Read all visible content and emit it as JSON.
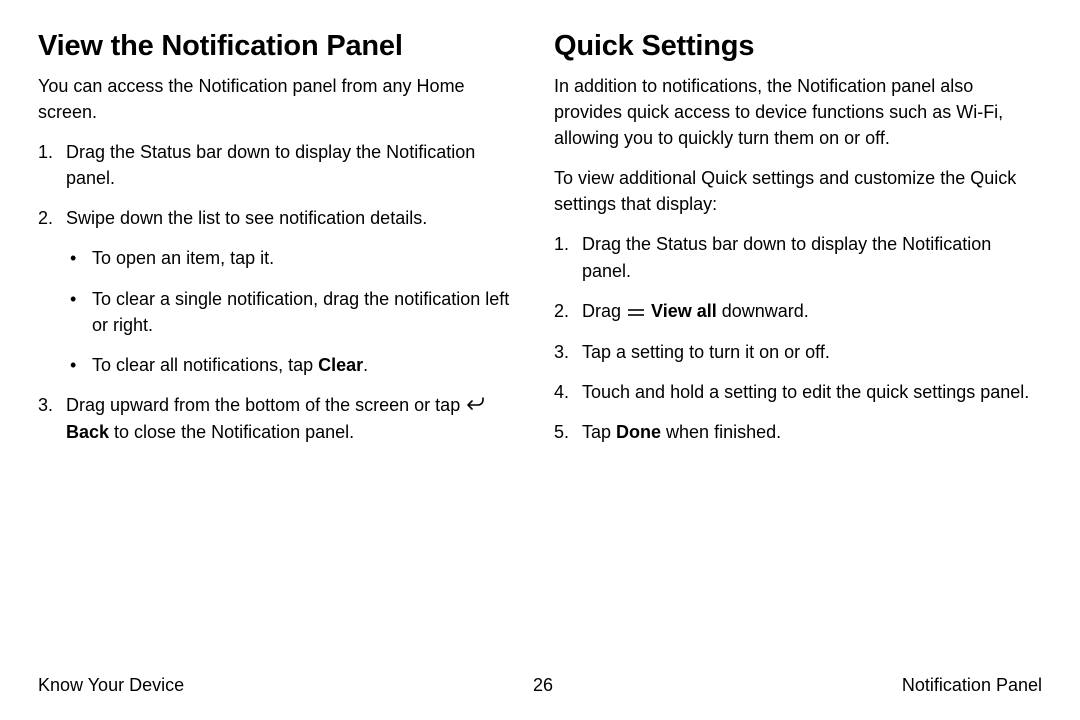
{
  "left": {
    "heading": "View the Notification Panel",
    "intro": "You can access the Notification panel from any Home screen.",
    "step1": "Drag the Status bar down to display the Notification panel.",
    "step2": "Swipe down the list to see notification details.",
    "bullet1": "To open an item, tap it.",
    "bullet2": "To clear a single notification, drag the notification left or right.",
    "bullet3_pre": "To clear all notifications, tap ",
    "bullet3_bold": "Clear",
    "bullet3_post": ".",
    "step3_pre": "Drag upward from the bottom of the screen or tap ",
    "step3_bold": "Back",
    "step3_post": " to close the Notification panel."
  },
  "right": {
    "heading": "Quick Settings",
    "intro1": "In addition to notifications, the Notification panel also provides quick access to device functions such as Wi‑Fi, allowing you to quickly turn them on or off.",
    "intro2": "To view additional Quick settings and customize the Quick settings that display:",
    "step1": "Drag the Status bar down to display the Notification panel.",
    "step2_pre": "Drag ",
    "step2_bold": "View all",
    "step2_post": " downward.",
    "step3": "Tap a setting to turn it on or off.",
    "step4": "Touch and hold a setting to edit the quick settings panel.",
    "step5_pre": "Tap ",
    "step5_bold": "Done",
    "step5_post": " when finished."
  },
  "footer": {
    "left": "Know Your Device",
    "center": "26",
    "right": "Notification Panel"
  }
}
